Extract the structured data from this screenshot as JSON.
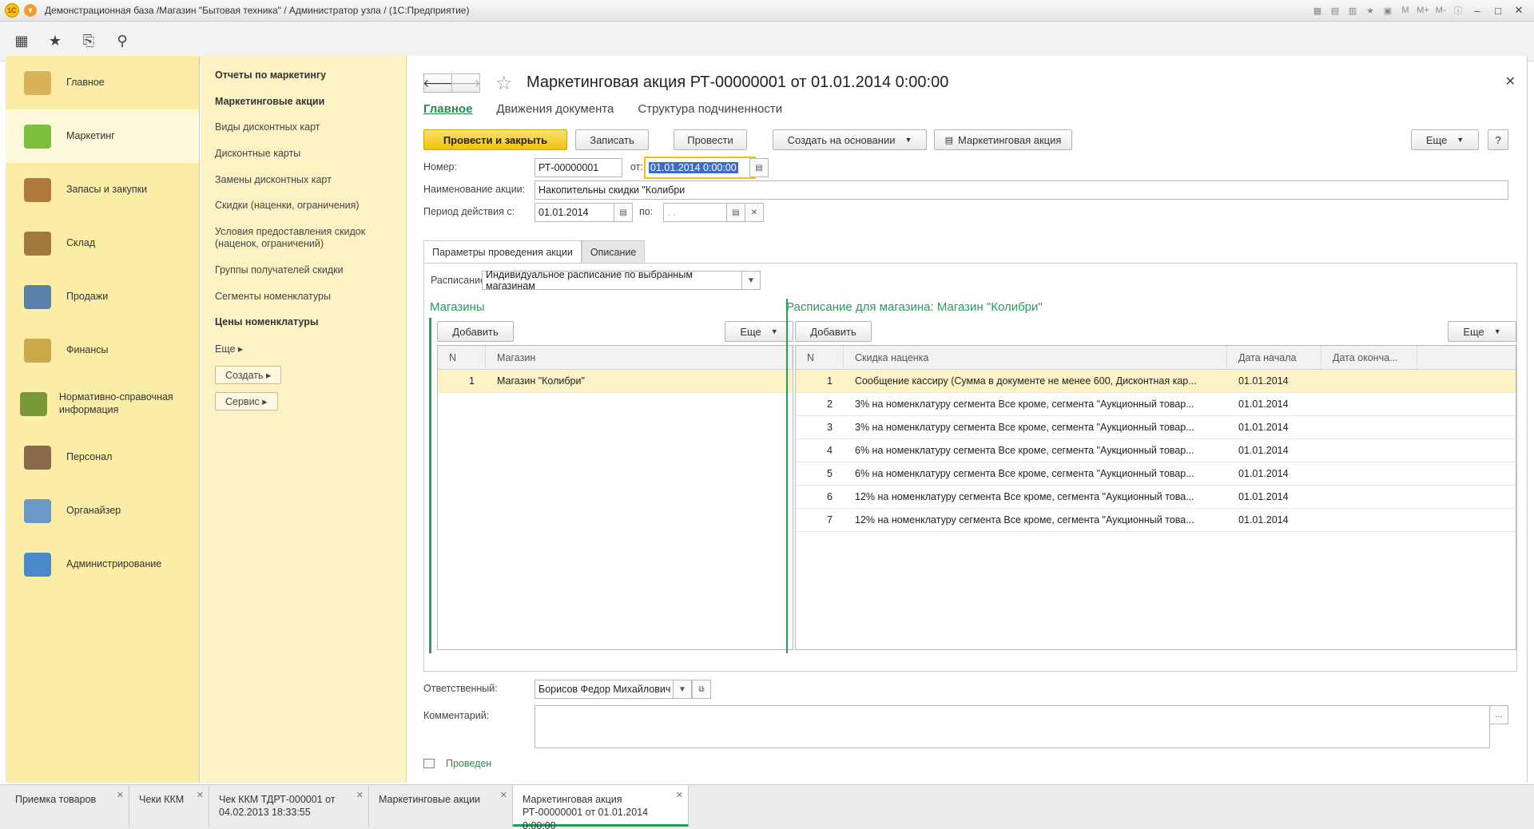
{
  "window": {
    "title": "Демонстрационная база /Магазин \"Бытовая техника\" / Администратор узла /  (1С:Предприятие)"
  },
  "sections": [
    {
      "label": "Главное",
      "icon": "desk-lamp-icon",
      "color": "#d8b35a"
    },
    {
      "label": "Маркетинг",
      "icon": "pie-chart-icon",
      "color": "#7cbf3a",
      "active": true
    },
    {
      "label": "Запасы и закупки",
      "icon": "boxes-icon",
      "color": "#b07a3a"
    },
    {
      "label": "Склад",
      "icon": "shelf-icon",
      "color": "#a0793f"
    },
    {
      "label": "Продажи",
      "icon": "cash-register-icon",
      "color": "#5a7fa8"
    },
    {
      "label": "Финансы",
      "icon": "coins-icon",
      "color": "#c9a94a"
    },
    {
      "label": "Нормативно-справочная информация",
      "icon": "binders-icon",
      "color": "#7a9a3a"
    },
    {
      "label": "Персонал",
      "icon": "person-icon",
      "color": "#8a6a4a"
    },
    {
      "label": "Органайзер",
      "icon": "clipboard-icon",
      "color": "#6a9ac8"
    },
    {
      "label": "Администрирование",
      "icon": "computer-icon",
      "color": "#4a8ac8"
    }
  ],
  "functions": {
    "items": [
      {
        "label": "Отчеты по маркетингу",
        "bold": true
      },
      {
        "label": "Маркетинговые акции",
        "bold": true
      },
      {
        "label": "Виды дисконтных карт"
      },
      {
        "label": "Дисконтные карты"
      },
      {
        "label": "Замены дисконтных карт"
      },
      {
        "label": "Скидки (наценки, ограничения)"
      },
      {
        "label": "Условия предоставления скидок (наценок, ограничений)"
      },
      {
        "label": "Группы получателей скидки"
      },
      {
        "label": "Сегменты номенклатуры"
      },
      {
        "label": "Цены номенклатуры",
        "bold": true
      }
    ],
    "more": "Еще",
    "create": "Создать",
    "service": "Сервис"
  },
  "form": {
    "title": "Маркетинговая акция РТ-00000001 от 01.01.2014 0:00:00",
    "tabs": [
      "Главное",
      "Движения документа",
      "Структура подчиненности"
    ],
    "buttons": {
      "post_close": "Провести и закрыть",
      "write": "Записать",
      "post": "Провести",
      "create_based": "Создать на основании",
      "print": "Маркетинговая акция",
      "more": "Еще",
      "help": "?"
    },
    "fields": {
      "number_label": "Номер:",
      "number": "РТ-00000001",
      "from_label": "от:",
      "date": "01.01.2014  0:00:00",
      "name_label": "Наименование акции:",
      "name": "Накопительны скидки \"Колибри",
      "period_label": "Период действия с:",
      "period_from": "01.01.2014",
      "period_to_label": "по:",
      "period_to": "  .  .",
      "responsible_label": "Ответственный:",
      "responsible": "Борисов Федор Михайлович",
      "comment_label": "Комментарий:",
      "comment": ""
    },
    "inner_tabs": [
      "Параметры проведения акции",
      "Описание"
    ],
    "schedule_label": "Расписание:",
    "schedule_value": "Индивидуальное расписание по выбранным магазинам",
    "stores": {
      "title": "Магазины",
      "add": "Добавить",
      "more": "Еще",
      "columns": [
        "N",
        "Магазин"
      ],
      "rows": [
        {
          "n": "1",
          "name": "Магазин \"Колибри\""
        }
      ]
    },
    "schedule": {
      "title": "Расписание для магазина: Магазин \"Колибри\"",
      "add": "Добавить",
      "more": "Еще",
      "columns": [
        "N",
        "Скидка наценка",
        "Дата начала",
        "Дата оконча..."
      ],
      "rows": [
        {
          "n": "1",
          "discount": "Сообщение кассиру (Сумма в документе не менее 600, Дисконтная кар...",
          "start": "01.01.2014",
          "end": ""
        },
        {
          "n": "2",
          "discount": "3% на номенклатуру сегмента Все кроме, сегмента \"Аукционный товар...",
          "start": "01.01.2014",
          "end": ""
        },
        {
          "n": "3",
          "discount": "3% на номенклатуру сегмента Все кроме, сегмента \"Аукционный товар...",
          "start": "01.01.2014",
          "end": ""
        },
        {
          "n": "4",
          "discount": "6% на номенклатуру сегмента Все кроме, сегмента \"Аукционный товар...",
          "start": "01.01.2014",
          "end": ""
        },
        {
          "n": "5",
          "discount": "6% на номенклатуру сегмента Все кроме, сегмента \"Аукционный товар...",
          "start": "01.01.2014",
          "end": ""
        },
        {
          "n": "6",
          "discount": "12% на номенклатуру сегмента Все кроме, сегмента \"Аукционный това...",
          "start": "01.01.2014",
          "end": ""
        },
        {
          "n": "7",
          "discount": "12% на номенклатуру сегмента Все кроме, сегмента \"Аукционный това...",
          "start": "01.01.2014",
          "end": ""
        }
      ]
    },
    "status": "Проведен"
  },
  "open_windows": [
    {
      "label": "Приемка товаров"
    },
    {
      "label": "Чеки ККМ"
    },
    {
      "label": "Чек ККМ ТДРТ-000001 от 04.02.2013 18:33:55"
    },
    {
      "label": "Маркетинговые акции"
    },
    {
      "label": "Маркетинговая акция РТ-00000001 от 01.01.2014 0:00:00",
      "active": true
    }
  ],
  "colors": {
    "accent_green": "#2a9a58",
    "primary_yellow": "#f2c20a",
    "sections_bg": "#fbeda6",
    "functions_bg": "#fcf2c4",
    "selected_row": "#fbf3c5"
  }
}
